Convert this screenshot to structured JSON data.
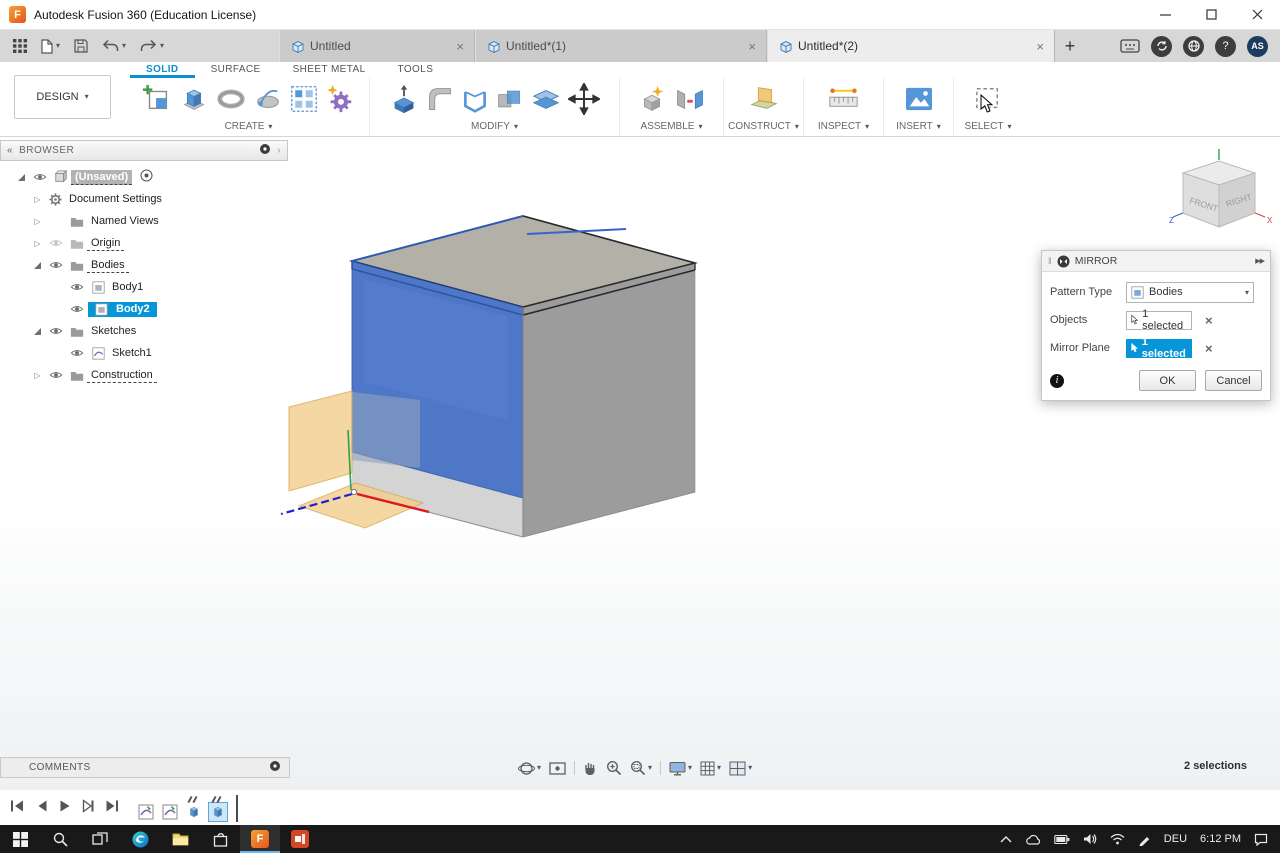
{
  "titlebar": {
    "title": "Autodesk Fusion 360 (Education License)"
  },
  "doc_tabs": {
    "items": [
      {
        "label": "Untitled"
      },
      {
        "label": "Untitled*(1)"
      },
      {
        "label": "Untitled*(2)"
      }
    ],
    "avatar": "AS"
  },
  "ribbon": {
    "design_label": "DESIGN",
    "tabs": [
      {
        "label": "SOLID"
      },
      {
        "label": "SURFACE"
      },
      {
        "label": "SHEET METAL"
      },
      {
        "label": "TOOLS"
      }
    ],
    "groups": [
      {
        "label": "CREATE"
      },
      {
        "label": "MODIFY"
      },
      {
        "label": "ASSEMBLE"
      },
      {
        "label": "CONSTRUCT"
      },
      {
        "label": "INSPECT"
      },
      {
        "label": "INSERT"
      },
      {
        "label": "SELECT"
      }
    ]
  },
  "browser": {
    "header": "BROWSER",
    "items": [
      {
        "label": "(Unsaved)"
      },
      {
        "label": "Document Settings"
      },
      {
        "label": "Named Views"
      },
      {
        "label": "Origin"
      },
      {
        "label": "Bodies"
      },
      {
        "label": "Body1"
      },
      {
        "label": "Body2"
      },
      {
        "label": "Sketches"
      },
      {
        "label": "Sketch1"
      },
      {
        "label": "Construction"
      }
    ]
  },
  "viewcube": {
    "front": "FRONT",
    "right": "RIGHT",
    "axis_x": "X",
    "axis_z": "Z"
  },
  "mirror_dialog": {
    "title": "MIRROR",
    "pattern_type_label": "Pattern Type",
    "pattern_type_value": "Bodies",
    "objects_label": "Objects",
    "objects_value": "1 selected",
    "mirror_plane_label": "Mirror Plane",
    "mirror_plane_value": "1 selected",
    "ok_label": "OK",
    "cancel_label": "Cancel"
  },
  "comments": {
    "label": "COMMENTS"
  },
  "status": {
    "selections": "2 selections"
  },
  "taskbar": {
    "language": "DEU",
    "time": "6:12 PM"
  }
}
